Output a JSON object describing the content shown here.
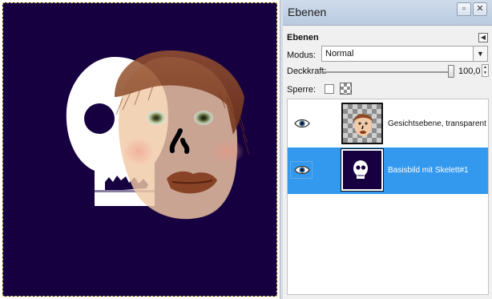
{
  "dock": {
    "title": "Ebenen",
    "tab_label": "Ebenen",
    "mode_label": "Modus:",
    "mode_value": "Normal",
    "opacity_label": "Deckkraft:",
    "opacity_value": "100,0",
    "opacity_fraction": 1.0,
    "lock_label": "Sperre:"
  },
  "layers": [
    {
      "name": "Gesichtsebene, transparent",
      "visible": true,
      "selected": false,
      "thumbnail_icon": "face-icon"
    },
    {
      "name": "Basisbild mit Skelett#1",
      "visible": true,
      "selected": true,
      "thumbnail_icon": "skull-icon"
    }
  ],
  "colors": {
    "canvas_background": "#16003f",
    "selection_highlight": "#3399ee",
    "hair": "#8c4a25",
    "skin": "#f1c9a6",
    "lips": "#8a3c18"
  }
}
